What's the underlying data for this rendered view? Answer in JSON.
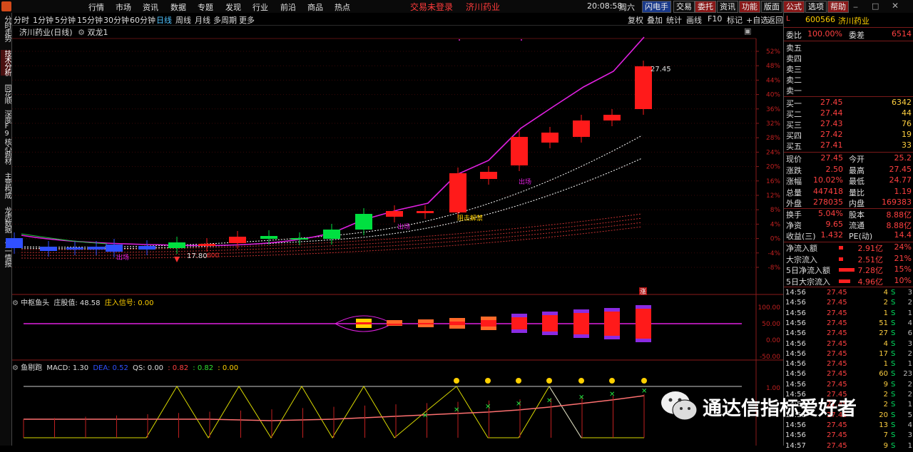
{
  "topbar": {
    "menu": [
      "行情",
      "市场",
      "资讯",
      "数据",
      "专题",
      "发现",
      "行业",
      "前沿",
      "商品",
      "热点"
    ],
    "login_status": "交易未登录",
    "stock_name": "济川药业",
    "time": "20:08:58",
    "weekday": "周六",
    "buttons": [
      "闪电手",
      "交易",
      "委托",
      "资讯",
      "功能",
      "版面",
      "公式",
      "选项",
      "帮助"
    ]
  },
  "periods": [
    "分时",
    "1分钟",
    "5分钟",
    "15分钟",
    "30分钟",
    "60分钟",
    "日线",
    "周线",
    "月线",
    "多周期",
    "更多"
  ],
  "active_period": "日线",
  "right_tools": [
    "复权",
    "叠加",
    "统计",
    "画线",
    "F10",
    "标记",
    "+自选",
    "返回"
  ],
  "left_tabs": [
    "分时走势",
    "技术分析",
    "同花顺",
    "深度F9",
    "核心题材",
    "主营构成",
    "龙虎数据",
    "第一情报"
  ],
  "chart": {
    "title": "济川药业(日线)",
    "indicator": "双龙1",
    "max_label": "27.45",
    "min_label": "17.80",
    "annotations": {
      "a1": "出场",
      "a2": "出场",
      "a3": "出场",
      "a4": "阻击解禁",
      "a5": "出场",
      "a6": "600",
      "a7": "涨"
    },
    "y_axis": [
      "52%",
      "48%",
      "44%",
      "40%",
      "36%",
      "32%",
      "28%",
      "24%",
      "20%",
      "16%",
      "12%",
      "8%",
      "4%",
      "0%",
      "-4%",
      "-8%"
    ],
    "sub1_title": "中枢鱼头",
    "sub1_values": "庄股值: 48.58",
    "sub1_signal": "庄入信号: 0.00",
    "sub1_axis": [
      "100.00",
      "50.00",
      "0.00",
      "-50.00"
    ],
    "sub2_title": "鱼剔跑",
    "sub2_macd": "MACD: 1.30",
    "sub2_dea": "DEA: 0.52",
    "sub2_qs": "QS: 0.00",
    "sub2_v1": ": 0.82",
    "sub2_v2": ": 0.82",
    "sub2_v3": ": 0.00",
    "sub2_axis": [
      "1.00"
    ]
  },
  "colors": {
    "up": "#ff1a1a",
    "down": "#00e040",
    "ma": "#e020e0",
    "yellow": "#ffd000",
    "purple": "#8a2be2"
  },
  "quote": {
    "code": "600566",
    "name": "济川药业",
    "webi_label": "委比",
    "webi": "100.00%",
    "weicha_label": "委差",
    "weicha": "6514",
    "sell": [
      {
        "k": "卖五"
      },
      {
        "k": "卖四"
      },
      {
        "k": "卖三"
      },
      {
        "k": "卖二"
      },
      {
        "k": "卖一"
      }
    ],
    "buy": [
      {
        "k": "买一",
        "p": "27.45",
        "v": "6342"
      },
      {
        "k": "买二",
        "p": "27.44",
        "v": "44"
      },
      {
        "k": "买三",
        "p": "27.43",
        "v": "76"
      },
      {
        "k": "买四",
        "p": "27.42",
        "v": "19"
      },
      {
        "k": "买五",
        "p": "27.41",
        "v": "33"
      }
    ],
    "stats": [
      {
        "k": "现价",
        "v": "27.45",
        "k2": "今开",
        "v2": "25.2"
      },
      {
        "k": "涨跌",
        "v": "2.50",
        "k2": "最高",
        "v2": "27.45"
      },
      {
        "k": "涨幅",
        "v": "10.02%",
        "k2": "最低",
        "v2": "24.77"
      },
      {
        "k": "总量",
        "v": "447418",
        "k2": "量比",
        "v2": "1.19"
      },
      {
        "k": "外盘",
        "v": "278035",
        "k2": "内盘",
        "v2": "169383"
      }
    ],
    "fund": [
      {
        "k": "换手",
        "v": "5.04%",
        "k2": "股本",
        "v2": "8.88亿"
      },
      {
        "k": "净资",
        "v": "9.65",
        "k2": "流通",
        "v2": "8.88亿"
      },
      {
        "k": "收益(三)",
        "v": "1.432",
        "k2": "PE(动)",
        "v2": "14.4"
      }
    ],
    "flows": [
      {
        "k": "净流入额",
        "v": "2.91亿",
        "p": "24%"
      },
      {
        "k": "大宗流入",
        "v": "2.51亿",
        "p": "21%"
      },
      {
        "k": "5日净流入额",
        "v": "7.28亿",
        "p": "15%"
      },
      {
        "k": "5日大宗流入",
        "v": "4.96亿",
        "p": "10%"
      }
    ],
    "ticks": [
      {
        "t": "14:56",
        "p": "27.45",
        "v": "4",
        "s": "S",
        "n": "3"
      },
      {
        "t": "14:56",
        "p": "27.45",
        "v": "2",
        "s": "S",
        "n": "2"
      },
      {
        "t": "14:56",
        "p": "27.45",
        "v": "1",
        "s": "S",
        "n": "1"
      },
      {
        "t": "14:56",
        "p": "27.45",
        "v": "51",
        "s": "S",
        "n": "4"
      },
      {
        "t": "14:56",
        "p": "27.45",
        "v": "27",
        "s": "S",
        "n": "6"
      },
      {
        "t": "14:56",
        "p": "27.45",
        "v": "4",
        "s": "S",
        "n": "3"
      },
      {
        "t": "14:56",
        "p": "27.45",
        "v": "17",
        "s": "S",
        "n": "2"
      },
      {
        "t": "14:56",
        "p": "27.45",
        "v": "1",
        "s": "S",
        "n": "1"
      },
      {
        "t": "14:56",
        "p": "27.45",
        "v": "60",
        "s": "S",
        "n": "23"
      },
      {
        "t": "14:56",
        "p": "27.45",
        "v": "9",
        "s": "S",
        "n": "2"
      },
      {
        "t": "14:56",
        "p": "27.45",
        "v": "2",
        "s": "S",
        "n": "2"
      },
      {
        "t": "14:56",
        "p": "27.45",
        "v": "2",
        "s": "S",
        "n": "1"
      },
      {
        "t": "14:56",
        "p": "27.45",
        "v": "20",
        "s": "S",
        "n": "5"
      },
      {
        "t": "14:56",
        "p": "27.45",
        "v": "13",
        "s": "S",
        "n": "4"
      },
      {
        "t": "14:56",
        "p": "27.45",
        "v": "7",
        "s": "S",
        "n": "3"
      },
      {
        "t": "14:57",
        "p": "27.45",
        "v": "9",
        "s": "S",
        "n": "1"
      }
    ]
  },
  "watermark": "通达信指标爱好者"
}
